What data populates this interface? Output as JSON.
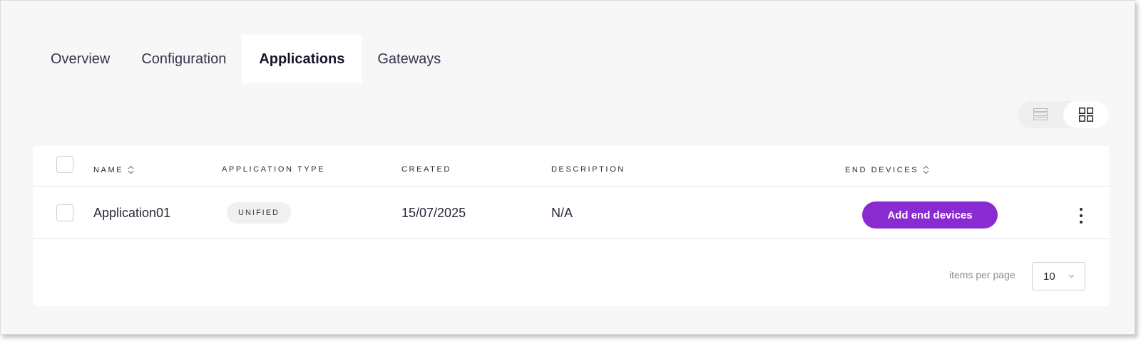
{
  "tabs": [
    {
      "label": "Overview"
    },
    {
      "label": "Configuration"
    },
    {
      "label": "Applications",
      "active": true
    },
    {
      "label": "Gateways"
    }
  ],
  "view_toggle": {
    "options": [
      "list-view-icon",
      "grid-view-icon"
    ],
    "selected": "grid-view-icon"
  },
  "table": {
    "headers": {
      "name": "NAME",
      "application_type": "APPLICATION TYPE",
      "created": "CREATED",
      "description": "DESCRIPTION",
      "end_devices": "END DEVICES"
    },
    "rows": [
      {
        "name": "Application01",
        "application_type": "UNIFIED",
        "created": "15/07/2025",
        "description": "N/A",
        "action_label": "Add end devices"
      }
    ]
  },
  "pagination": {
    "items_per_page_label": "items per page",
    "items_per_page_value": "10"
  },
  "colors": {
    "accent": "#8a2bd1",
    "page_background": "#f7f7f7",
    "card_background": "#ffffff"
  }
}
